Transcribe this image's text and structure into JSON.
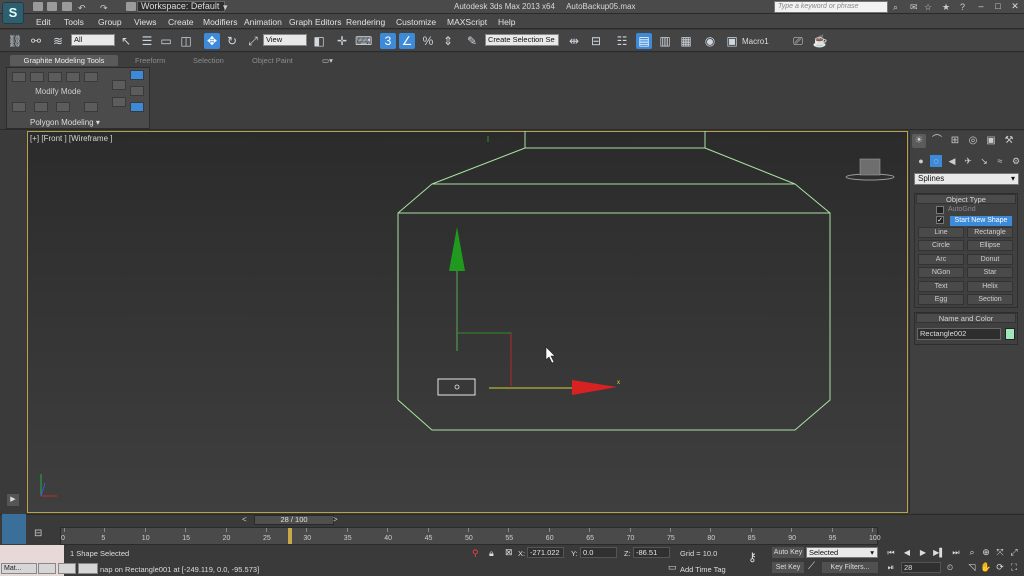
{
  "title_bar": {
    "workspace": "Workspace: Default",
    "app_title": "Autodesk 3ds Max  2013 x64",
    "file_name": "AutoBackup05.max",
    "search_placeholder": "Type a keyword or phrase"
  },
  "menu": [
    "Edit",
    "Tools",
    "Group",
    "Views",
    "Create",
    "Modifiers",
    "Animation",
    "Graph Editors",
    "Rendering",
    "Customize",
    "MAXScript",
    "Help"
  ],
  "toolbar": {
    "filter_value": "All",
    "ref_coord": "View",
    "named_selection": "Create Selection Se",
    "macro_label": "Macro1"
  },
  "ribbon": {
    "tabs": [
      "Graphite Modeling Tools",
      "Freeform",
      "Selection",
      "Object Paint"
    ],
    "modify_mode": "Modify Mode",
    "polygon_modeling": "Polygon Modeling"
  },
  "viewport": {
    "label": "[+] [Front ] [Wireframe ]",
    "axis_x_label": "x"
  },
  "command_panel": {
    "category": "Splines",
    "object_type_title": "Object Type",
    "autogrid": "AutoGrid",
    "start_new_shape": "Start New Shape",
    "start_new_shape_checked": true,
    "buttons": [
      "Line",
      "Rectangle",
      "Circle",
      "Ellipse",
      "Arc",
      "Donut",
      "NGon",
      "Star",
      "Text",
      "Helix",
      "Egg",
      "Section"
    ],
    "name_color_title": "Name and Color",
    "object_name": "Rectangle002",
    "object_color": "#9fe6b8"
  },
  "timeline": {
    "slider_text": "28 / 100",
    "current_frame": 28,
    "range": [
      0,
      100
    ],
    "ticks": [
      0,
      5,
      10,
      15,
      20,
      25,
      30,
      35,
      40,
      45,
      50,
      55,
      60,
      65,
      70,
      75,
      80,
      85,
      90,
      95,
      100
    ]
  },
  "status": {
    "selection": "1 Shape Selected",
    "prompt": "nap on Rectangle001 at [-249.119, 0.0, -95.573]",
    "x_label": "X:",
    "x_value": "-271.022",
    "y_label": "Y:",
    "y_value": "0.0",
    "z_label": "Z:",
    "z_value": "-86.51",
    "grid": "Grid = 10.0",
    "add_time_tag": "Add Time Tag",
    "auto_key": "Auto Key",
    "set_key": "Set Key",
    "key_mode": "Selected",
    "key_filters": "Key Filters...",
    "frame": "28"
  },
  "taskbar": [
    "Mat...",
    "",
    "",
    ""
  ]
}
